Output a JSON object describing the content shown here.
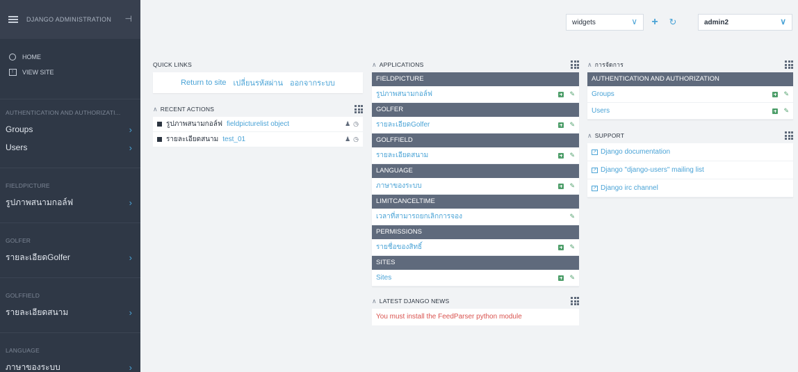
{
  "sidebar": {
    "brand": "DJANGO ADMINISTRATION",
    "home": "HOME",
    "view_site": "VIEW SITE",
    "sections": [
      {
        "title": "AUTHENTICATION AND AUTHORIZATI...",
        "items": [
          "Groups",
          "Users"
        ]
      },
      {
        "title": "FIELDPICTURE",
        "items": [
          "รูปภาพสนามกอล์ฟ"
        ]
      },
      {
        "title": "GOLFER",
        "items": [
          "รายละเอียดGolfer"
        ]
      },
      {
        "title": "GOLFFIELD",
        "items": [
          "รายละเอียดสนาม"
        ]
      },
      {
        "title": "LANGUAGE",
        "items": [
          "ภาษาของระบบ"
        ]
      }
    ]
  },
  "topbar": {
    "widgets_select": "widgets",
    "user_select": "admin2"
  },
  "quick_links": {
    "title": "QUICK LINKS",
    "links": [
      "Return to site",
      "เปลี่ยนรหัสผ่าน",
      "ออกจากระบบ"
    ]
  },
  "recent_actions": {
    "title": "RECENT ACTIONS",
    "items": [
      {
        "model": "รูปภาพสนามกอล์ฟ",
        "object": "fieldpicturelist object"
      },
      {
        "model": "รายละเอียดสนาม",
        "object": "test_01"
      }
    ]
  },
  "applications": {
    "title": "APPLICATIONS",
    "groups": [
      {
        "name": "FIELDPICTURE",
        "models": [
          {
            "label": "รูปภาพสนามกอล์ฟ",
            "add": true
          }
        ]
      },
      {
        "name": "GOLFER",
        "models": [
          {
            "label": "รายละเอียดGolfer",
            "add": true
          }
        ]
      },
      {
        "name": "GOLFFIELD",
        "models": [
          {
            "label": "รายละเอียดสนาม",
            "add": true
          }
        ]
      },
      {
        "name": "LANGUAGE",
        "models": [
          {
            "label": "ภาษาของระบบ",
            "add": true
          }
        ]
      },
      {
        "name": "LIMITCANCELTIME",
        "models": [
          {
            "label": "เวลาที่สามารถยกเลิกการจอง",
            "add": false
          }
        ]
      },
      {
        "name": "PERMISSIONS",
        "models": [
          {
            "label": "รายชื่อของสิทธิ์",
            "add": true
          }
        ]
      },
      {
        "name": "SITES",
        "models": [
          {
            "label": "Sites",
            "add": true
          }
        ]
      }
    ]
  },
  "latest_news": {
    "title": "LATEST DJANGO NEWS",
    "message": "You must install the FeedParser python module"
  },
  "management": {
    "title": "การจัดการ",
    "group": "AUTHENTICATION AND AUTHORIZATION",
    "models": [
      "Groups",
      "Users"
    ]
  },
  "support": {
    "title": "SUPPORT",
    "links": [
      "Django documentation",
      "Django \"django-users\" mailing list",
      "Django irc channel"
    ]
  },
  "colors": {
    "sidebar_bg": "#2f3846",
    "group_header": "#5f6a7c",
    "link": "#4aa3d6",
    "add_green": "#4f9f6b",
    "error_red": "#d9534f"
  }
}
